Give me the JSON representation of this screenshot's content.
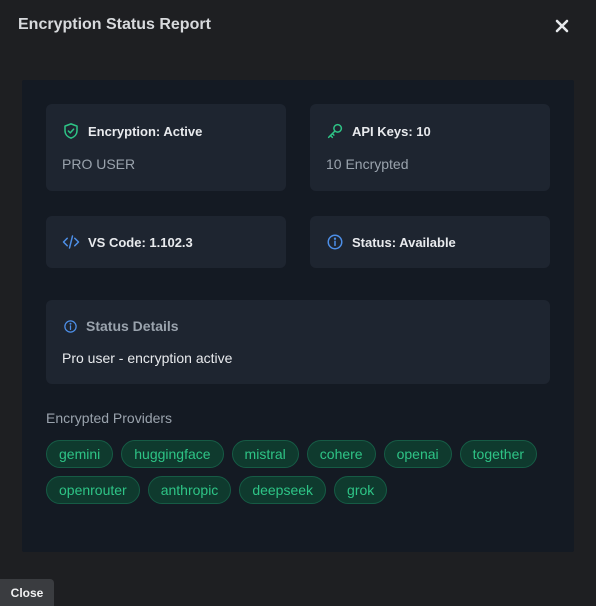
{
  "dialog": {
    "title": "Encryption Status Report"
  },
  "cards": {
    "encryption": {
      "title": "Encryption: Active",
      "sub": "PRO USER"
    },
    "api_keys": {
      "title": "API Keys: 10",
      "sub": "10 Encrypted"
    },
    "vscode": {
      "title": "VS Code: 1.102.3"
    },
    "status": {
      "title": "Status: Available"
    },
    "details": {
      "title": "Status Details",
      "text": "Pro user - encryption active"
    }
  },
  "providers": {
    "label": "Encrypted Providers",
    "items": [
      "gemini",
      "huggingface",
      "mistral",
      "cohere",
      "openai",
      "together",
      "openrouter",
      "anthropic",
      "deepseek",
      "grok"
    ]
  },
  "footer": {
    "close_label": "Close"
  },
  "colors": {
    "accent_green": "#2ec486",
    "accent_blue": "#4d8fe8"
  },
  "icons": {
    "close": "close-icon",
    "encryption": "shield-check-icon",
    "api_keys": "key-icon",
    "vscode": "code-icon",
    "status": "info-icon",
    "details": "info-icon"
  }
}
